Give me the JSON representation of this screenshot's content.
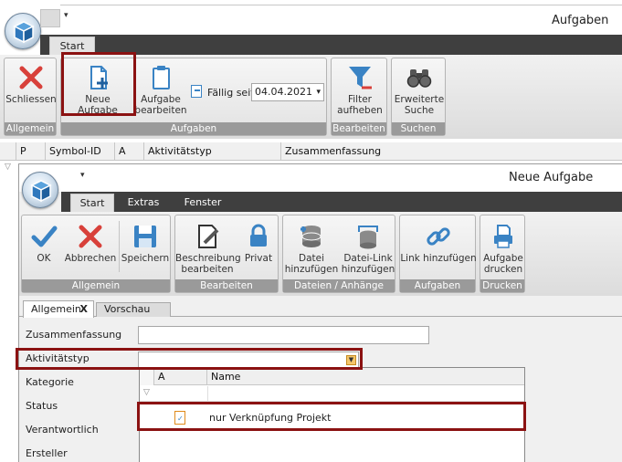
{
  "main_window": {
    "title": "Aufgaben",
    "tabs": [
      {
        "label": "Start"
      }
    ],
    "buttons": {
      "close": "Schliessen",
      "new_task": "Neue Aufgabe",
      "edit_task": "Aufgabe bearbeiten",
      "due_since_label": "Fällig seit",
      "due_since_value": "04.04.2021",
      "filter": "Filter aufheben",
      "extended_search": "Erweiterte Suche"
    },
    "groups": {
      "general": "Allgemein",
      "tasks": "Aufgaben",
      "edit": "Bearbeiten",
      "search": "Suchen"
    },
    "grid_columns": [
      "P",
      "Symbol-ID",
      "A",
      "Aktivitätstyp",
      "Zusammenfassung"
    ]
  },
  "dialog": {
    "title": "Neue Aufgabe",
    "tabs": [
      {
        "label": "Start"
      },
      {
        "label": "Extras"
      },
      {
        "label": "Fenster"
      }
    ],
    "buttons": {
      "ok": "OK",
      "cancel": "Abbrechen",
      "save": "Speichern",
      "edit_description": "Beschreibung bearbeiten",
      "private": "Privat",
      "add_file": "Datei hinzufügen",
      "add_file_link": "Datei-Link hinzufügen",
      "add_link": "Link hinzufügen",
      "print_task": "Aufgabe drucken"
    },
    "groups": {
      "general": "Allgemein",
      "edit": "Bearbeiten",
      "files": "Dateien / Anhänge",
      "tasks": "Aufgaben",
      "print": "Drucken"
    },
    "page_tabs": {
      "general": "Allgemein",
      "general_close": "X",
      "preview": "Vorschau"
    },
    "form": {
      "summary_label": "Zusammenfassung",
      "summary_value": "",
      "activity_type_label": "Aktivitätstyp",
      "activity_type_value": "",
      "category_label": "Kategorie",
      "status_label": "Status",
      "responsible_label": "Verantwortlich",
      "creator_label": "Ersteller"
    },
    "dropdown": {
      "columns": [
        "A",
        "Name"
      ],
      "rows": [
        {
          "name": "nur Verknüpfung Projekt",
          "icon": "task-clipboard-icon"
        }
      ]
    }
  },
  "colors": {
    "highlight_border": "#8b1212",
    "tabbar": "#3f3f3f",
    "group_label": "#9a9a9a",
    "accent_blue": "#3a83c4",
    "cancel_red": "#d8403a"
  }
}
